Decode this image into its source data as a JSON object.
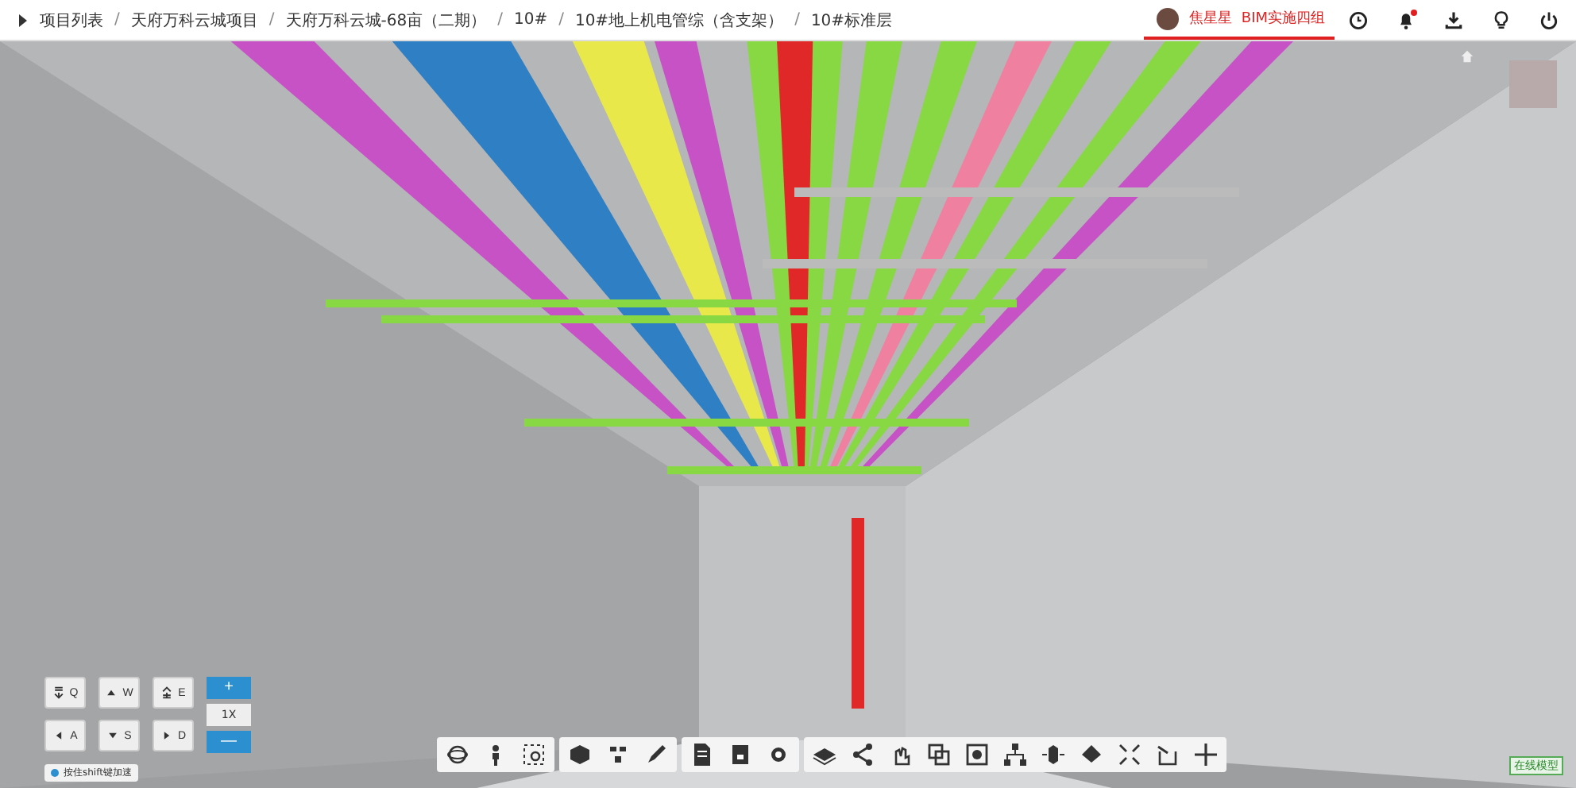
{
  "breadcrumbs": [
    {
      "label": "项目列表"
    },
    {
      "label": "天府万科云城项目"
    },
    {
      "label": "天府万科云城-68亩（二期）"
    },
    {
      "label": "10#"
    },
    {
      "label": "10#地上机电管综（含支架）"
    },
    {
      "label": "10#标准层"
    }
  ],
  "breadcrumb_separator": "/",
  "user": {
    "name": "焦星星",
    "team": "BIM实施四组"
  },
  "notification": {
    "unread": true
  },
  "keys": [
    {
      "label": "Q",
      "kind": "down"
    },
    {
      "label": "W",
      "kind": "forward"
    },
    {
      "label": "E",
      "kind": "up"
    },
    {
      "label": "A",
      "kind": "left"
    },
    {
      "label": "S",
      "kind": "back"
    },
    {
      "label": "D",
      "kind": "right"
    }
  ],
  "speed": {
    "plus": "+",
    "value": "1X",
    "minus": "—"
  },
  "hint": "按住shift键加速",
  "model_status": "在线模型"
}
